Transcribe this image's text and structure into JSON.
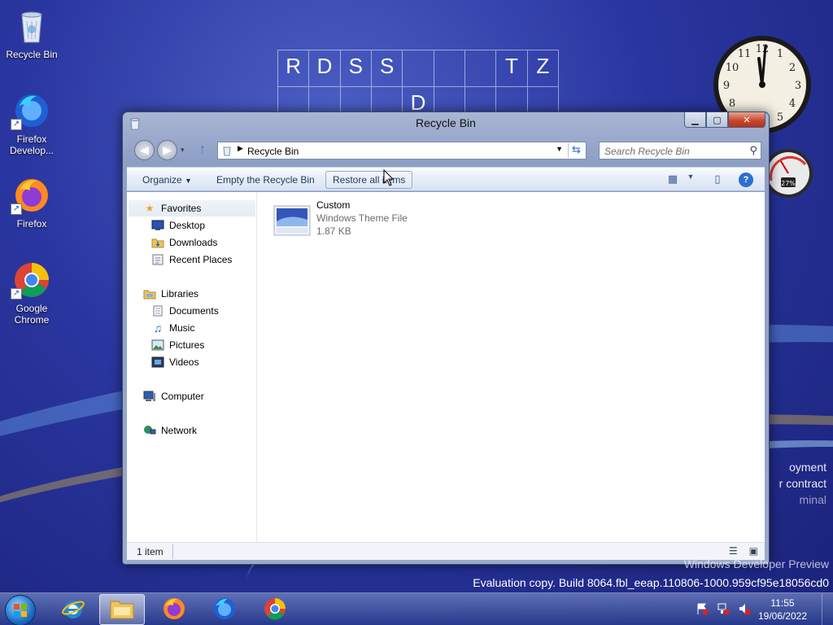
{
  "desktop": {
    "icons": [
      {
        "label": "Recycle Bin"
      },
      {
        "label": "Firefox Develop..."
      },
      {
        "label": "Firefox"
      },
      {
        "label": "Google Chrome"
      }
    ]
  },
  "crossword": {
    "row1": [
      "R",
      "D",
      "S",
      "S",
      "",
      "",
      "",
      "T",
      "Z"
    ],
    "row2": [
      "",
      "",
      "",
      "",
      "D",
      "",
      "",
      "",
      ""
    ]
  },
  "cpu_meter": {
    "percent": "27%"
  },
  "window": {
    "title": "Recycle Bin",
    "address_path": "Recycle Bin",
    "search_placeholder": "Search Recycle Bin",
    "toolbar": {
      "organize": "Organize",
      "empty": "Empty the Recycle Bin",
      "restore": "Restore all items"
    },
    "nav": {
      "favorites": "Favorites",
      "desktop": "Desktop",
      "downloads": "Downloads",
      "recent": "Recent Places",
      "libraries": "Libraries",
      "documents": "Documents",
      "music": "Music",
      "pictures": "Pictures",
      "videos": "Videos",
      "computer": "Computer",
      "network": "Network"
    },
    "file": {
      "name": "Custom",
      "type": "Windows Theme File",
      "size": "1.87 KB"
    },
    "status": {
      "count": "1 item"
    }
  },
  "watermark": {
    "side1": "oyment",
    "side2": "r contract",
    "side3": "minal",
    "line1": "Windows Developer Preview",
    "line2": "Evaluation copy. Build 8064.fbl_eeap.110806-1000.959cf95e18056cd0"
  },
  "taskbar": {
    "time": "11:55",
    "date": "19/06/2022"
  },
  "colors": {
    "accent": "#2b7bd4",
    "close_button": "#c6432a"
  }
}
